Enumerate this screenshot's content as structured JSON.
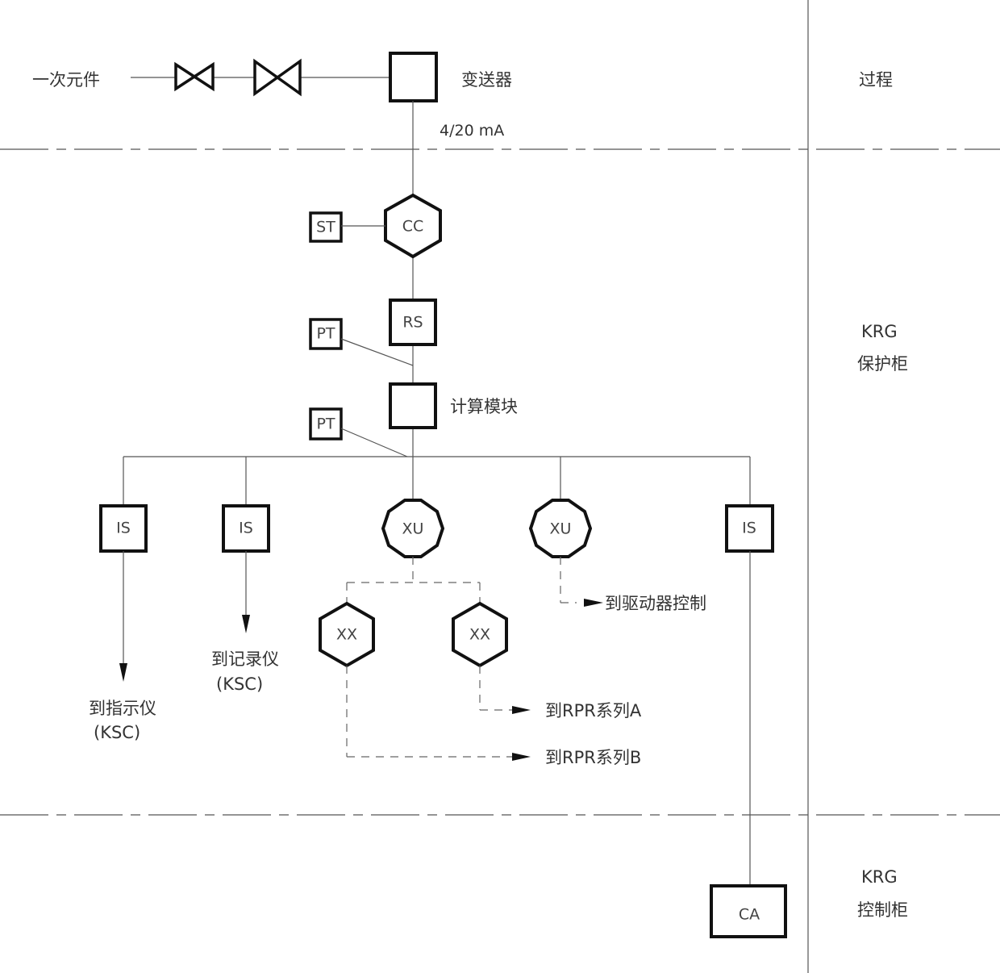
{
  "zones": {
    "process": "过程",
    "protection_cabinet_line1": "KRG",
    "protection_cabinet_line2": "保护柜",
    "control_cabinet_line1": "KRG",
    "control_cabinet_line2": "控制柜"
  },
  "top": {
    "primary_element": "一次元件",
    "transmitter": "变送器",
    "signal": "4/20 mA"
  },
  "nodes": {
    "cc": "CC",
    "st": "ST",
    "rs": "RS",
    "pt1": "PT",
    "pt2": "PT",
    "calc_module": "计算模块",
    "is1": "IS",
    "is2": "IS",
    "is3": "IS",
    "xu1": "XU",
    "xu2": "XU",
    "xx1": "XX",
    "xx2": "XX",
    "ca": "CA"
  },
  "outputs": {
    "indicator_line1": "到指示仪",
    "indicator_line2": "(KSC)",
    "recorder_line1": "到记录仪",
    "recorder_line2": "(KSC)",
    "actuator": "到驱动器控制",
    "rpr_a": "到RPR系列A",
    "rpr_b": "到RPR系列B"
  }
}
